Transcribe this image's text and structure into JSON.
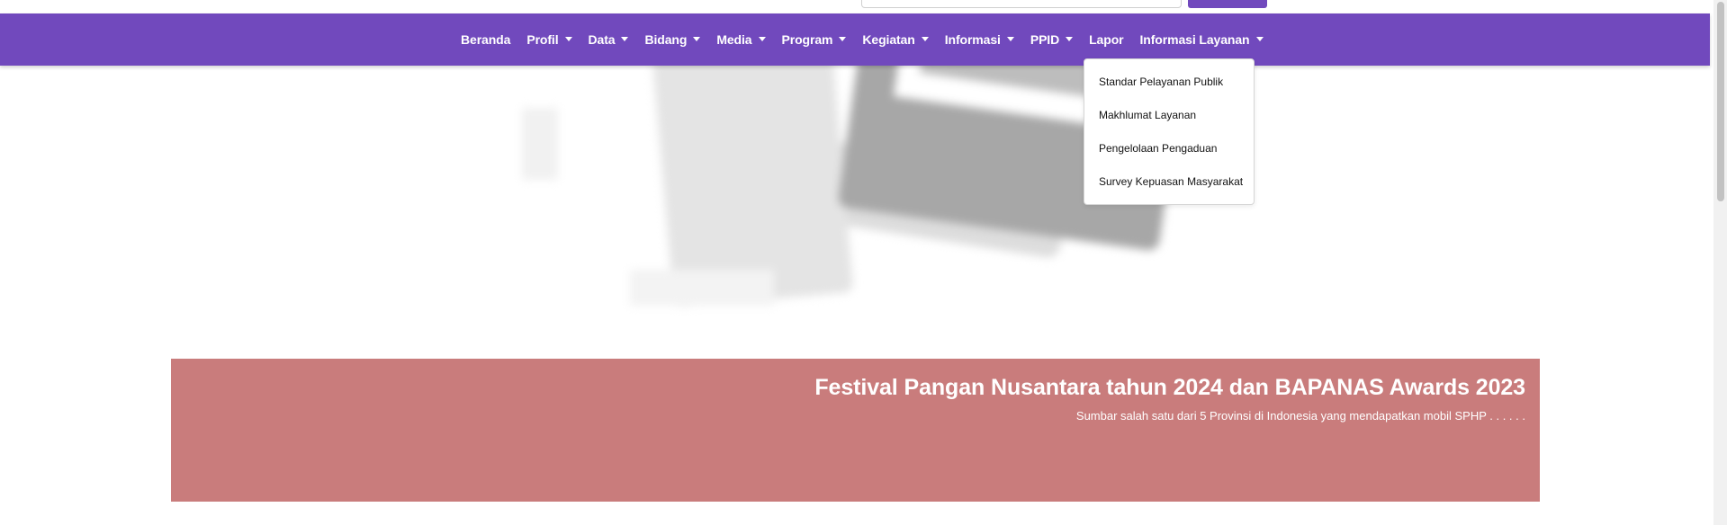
{
  "header": {
    "search_placeholder": ""
  },
  "nav": {
    "items": [
      {
        "label": "Beranda",
        "has_dropdown": false
      },
      {
        "label": "Profil",
        "has_dropdown": true
      },
      {
        "label": "Data",
        "has_dropdown": true
      },
      {
        "label": "Bidang",
        "has_dropdown": true
      },
      {
        "label": "Media",
        "has_dropdown": true
      },
      {
        "label": "Program",
        "has_dropdown": true
      },
      {
        "label": "Kegiatan",
        "has_dropdown": true
      },
      {
        "label": "Informasi",
        "has_dropdown": true
      },
      {
        "label": "PPID",
        "has_dropdown": true
      },
      {
        "label": "Lapor",
        "has_dropdown": false
      },
      {
        "label": "Informasi Layanan",
        "has_dropdown": true
      }
    ]
  },
  "dropdown": {
    "open_menu": "Informasi Layanan",
    "items": [
      {
        "label": "Standar Pelayanan Publik"
      },
      {
        "label": "Makhlumat Layanan"
      },
      {
        "label": "Pengelolaan Pengaduan"
      },
      {
        "label": "Survey Kepuasan Masyarakat"
      }
    ]
  },
  "banner": {
    "title": "Festival Pangan Nusantara tahun 2024 dan BAPANAS Awards 2023",
    "subtitle": "Sumbar salah satu dari 5 Provinsi di Indonesia yang mendapatkan mobil SPHP . . . . . ."
  },
  "colors": {
    "navbar": "#7149bd",
    "banner": "#c97c7c",
    "text_on_color": "#ffffff"
  }
}
